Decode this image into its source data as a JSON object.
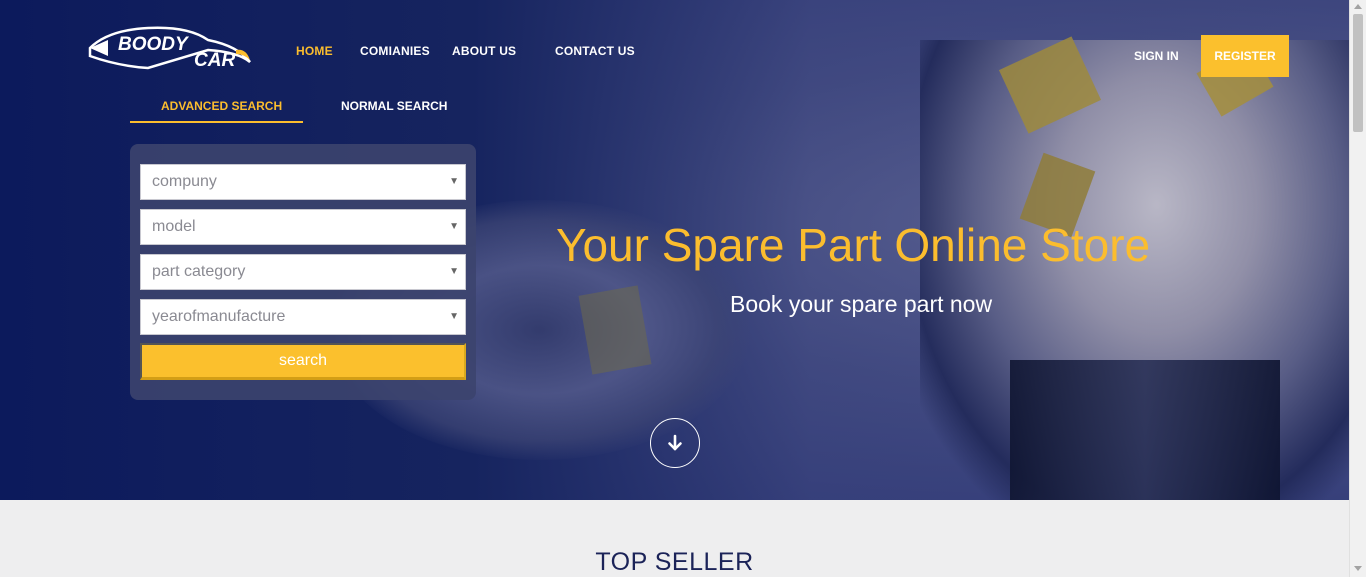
{
  "brand": {
    "logo_line1": "BOODY",
    "logo_line2": "CAR"
  },
  "nav": {
    "home": "HOME",
    "companies": "COMIANIES",
    "about": "ABOUT US",
    "contact": "CONTACT US",
    "signin": "SIGN IN",
    "register": "REGISTER"
  },
  "search_tabs": {
    "advanced": "ADVANCED SEARCH",
    "normal": "NORMAL SEARCH"
  },
  "search_form": {
    "company": "compuny",
    "model": "model",
    "part_category": "part category",
    "year": "yearofmanufacture",
    "button": "search"
  },
  "hero": {
    "title": "Your Spare Part Online Store",
    "subtitle": "Book your spare part now"
  },
  "section": {
    "top_seller": "TOP SELLER"
  },
  "colors": {
    "accent": "#fbc02d",
    "navy": "#0c1a5c",
    "title_navy": "#1b2358"
  },
  "icons": {
    "scroll_down": "arrow-down-icon",
    "select_caret": "caret-down-icon"
  }
}
